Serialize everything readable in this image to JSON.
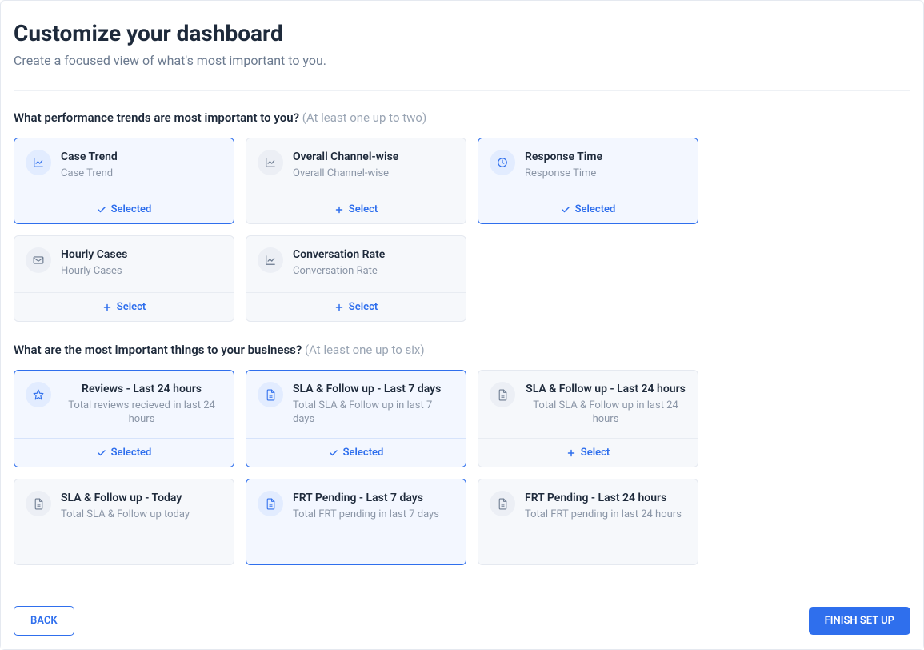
{
  "header": {
    "title": "Customize your dashboard",
    "subtitle": "Create a focused view of what's most important to you."
  },
  "sections": {
    "trends": {
      "question": "What performance trends are most important to you?",
      "hint": "(At least one up to two)",
      "cards": [
        {
          "title": "Case Trend",
          "desc": "Case Trend",
          "icon": "line-chart-icon",
          "selected": true,
          "centered": false
        },
        {
          "title": "Overall Channel-wise",
          "desc": "Overall Channel-wise",
          "icon": "line-chart-icon",
          "selected": false,
          "centered": false
        },
        {
          "title": "Response Time",
          "desc": "Response Time",
          "icon": "clock-icon",
          "selected": true,
          "centered": false
        },
        {
          "title": "Hourly Cases",
          "desc": "Hourly Cases",
          "icon": "mail-icon",
          "selected": false,
          "centered": false
        },
        {
          "title": "Conversation Rate",
          "desc": "Conversation Rate",
          "icon": "line-chart-icon",
          "selected": false,
          "centered": false
        }
      ]
    },
    "business": {
      "question": "What are the most important things to your business?",
      "hint": "(At least one up to six)",
      "cards": [
        {
          "title": "Reviews - Last 24 hours",
          "desc": "Total reviews recieved in last 24 hours",
          "icon": "star-icon",
          "selected": true,
          "centered": true
        },
        {
          "title": "SLA & Follow up - Last 7 days",
          "desc": "Total SLA & Follow up in last 7 days",
          "icon": "document-icon",
          "selected": true,
          "centered": false
        },
        {
          "title": "SLA & Follow up - Last 24 hours",
          "desc": "Total SLA & Follow up in last 24 hours",
          "icon": "document-icon",
          "selected": false,
          "centered": true
        },
        {
          "title": "SLA & Follow up - Today",
          "desc": "Total SLA & Follow up today",
          "icon": "document-icon",
          "selected": false,
          "centered": false
        },
        {
          "title": "FRT Pending - Last 7 days",
          "desc": "Total FRT pending in last 7 days",
          "icon": "document-icon",
          "selected": true,
          "centered": false
        },
        {
          "title": "FRT Pending - Last 24 hours",
          "desc": "Total FRT pending in last 24 hours",
          "icon": "document-icon",
          "selected": false,
          "centered": false
        }
      ]
    }
  },
  "labels": {
    "selected": "Selected",
    "select": "Select"
  },
  "footer": {
    "back": "BACK",
    "finish": "FINISH SET UP"
  },
  "colors": {
    "primary": "#2f6fed",
    "text": "#1e2a3b",
    "muted": "#6b7a8f"
  }
}
